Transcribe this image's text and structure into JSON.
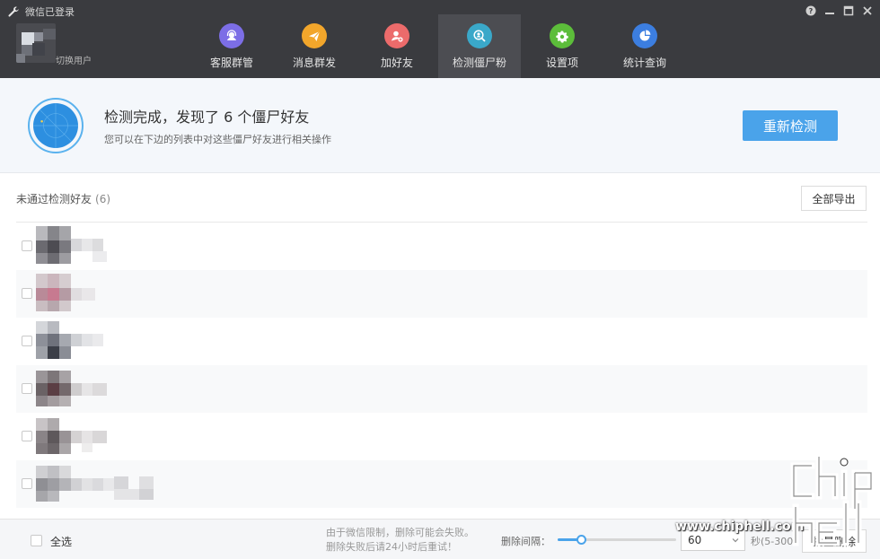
{
  "window": {
    "title": "微信已登录"
  },
  "user": {
    "switch_label": "切换用户"
  },
  "nav": [
    {
      "label": "客服群管",
      "color": "#7c6ee6",
      "icon": "headset-icon"
    },
    {
      "label": "消息群发",
      "color": "#f2a62b",
      "icon": "paper-plane-icon"
    },
    {
      "label": "加好友",
      "color": "#ec6b6b",
      "icon": "add-friend-icon"
    },
    {
      "label": "检测僵尸粉",
      "color": "#3aa8c9",
      "icon": "zombie-scan-icon"
    },
    {
      "label": "设置项",
      "color": "#5cbd3a",
      "icon": "gear-icon"
    },
    {
      "label": "统计查询",
      "color": "#3c7ee0",
      "icon": "pie-chart-icon"
    }
  ],
  "banner": {
    "title": "检测完成，发现了 6 个僵尸好友",
    "subtitle": "您可以在下边的列表中对这些僵尸好友进行相关操作",
    "recheck_label": "重新检测"
  },
  "list": {
    "heading": "未通过检测好友",
    "count": "(6)",
    "export_label": "全部导出"
  },
  "footer": {
    "select_all": "全选",
    "note_line1": "由于微信限制，删除可能会失败。",
    "note_line2": "删除失败后请24小时后重试！",
    "interval_label": "删除间隔：",
    "interval_value": "60",
    "interval_fraction": 0.2,
    "range_label": "秒(5-300)",
    "batch_delete": "批量删除"
  },
  "watermark": {
    "url": "www.chiphell.com"
  },
  "colors": {
    "header_bg": "#3a3b3f",
    "accent": "#4aa3ea"
  }
}
